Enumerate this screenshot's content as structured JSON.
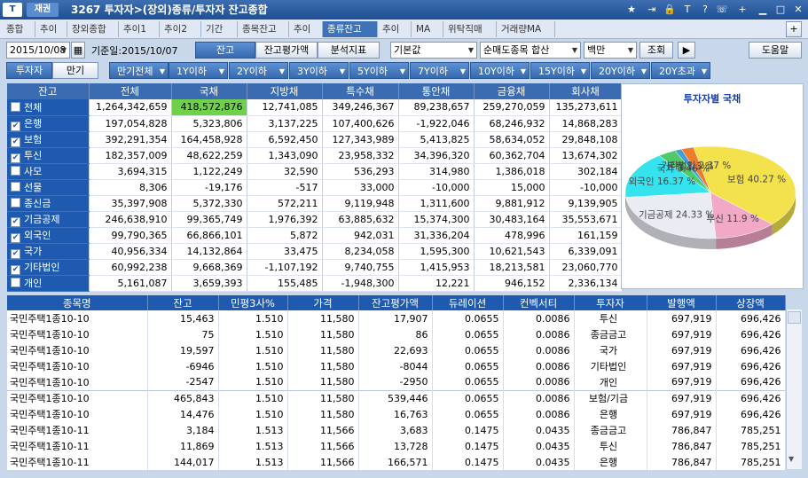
{
  "titlebar": {
    "logo": "T",
    "brand": "재권",
    "title": "3267 투자자>(장외)종류/투자자 잔고종합",
    "icons": [
      "star-icon",
      "exit-icon",
      "lock-icon",
      "text-icon",
      "help-icon",
      "phone-icon",
      "minimize-icon",
      "maximize-icon",
      "close-icon"
    ]
  },
  "tabs": [
    "종합",
    "추이",
    "장외종합",
    "추이1",
    "추이2",
    "기간",
    "종목잔고",
    "추이",
    "종류잔고",
    "추이",
    "MA",
    "위탁직매",
    "거래량MA"
  ],
  "tabs_active_index": 8,
  "toolbar": {
    "date": "2015/10/08",
    "ref_date": "기준일:2015/10/07",
    "balance": "잔고",
    "eval": "잔고평가액",
    "analysis": "분석지표",
    "basis": "기본값",
    "sort": "순매도종목 합산",
    "unit": "백만",
    "query": "조회",
    "next": "▶",
    "help": "도움말"
  },
  "investor_toggle": {
    "a": "투자자",
    "b": "만기"
  },
  "maturity_filters": [
    "만기전체",
    "1Y이하",
    "2Y이하",
    "3Y이하",
    "5Y이하",
    "7Y이하",
    "10Y이하",
    "15Y이하",
    "20Y이하",
    "20Y초과"
  ],
  "table1": {
    "headers": [
      "잔고",
      "전체",
      "국채",
      "지방채",
      "특수채",
      "통안채",
      "금융채",
      "회사채"
    ],
    "rows": [
      {
        "label": "전체",
        "checked": false,
        "v": [
          "1,264,342,659",
          "418,572,876",
          "12,741,085",
          "349,246,367",
          "89,238,657",
          "259,270,059",
          "135,273,611"
        ]
      },
      {
        "label": "은행",
        "checked": true,
        "v": [
          "197,054,828",
          "5,323,806",
          "3,137,225",
          "107,400,626",
          "-1,922,046",
          "68,246,932",
          "14,868,283"
        ]
      },
      {
        "label": "보험",
        "checked": true,
        "v": [
          "392,291,354",
          "164,458,928",
          "6,592,450",
          "127,343,989",
          "5,413,825",
          "58,634,052",
          "29,848,108"
        ]
      },
      {
        "label": "투신",
        "checked": true,
        "v": [
          "182,357,009",
          "48,622,259",
          "1,343,090",
          "23,958,332",
          "34,396,320",
          "60,362,704",
          "13,674,302"
        ]
      },
      {
        "label": "사모",
        "checked": false,
        "v": [
          "3,694,315",
          "1,122,249",
          "32,590",
          "536,293",
          "314,980",
          "1,386,018",
          "302,184"
        ]
      },
      {
        "label": "선물",
        "checked": false,
        "v": [
          "8,306",
          "-19,176",
          "-517",
          "33,000",
          "-10,000",
          "15,000",
          "-10,000"
        ]
      },
      {
        "label": "종신금",
        "checked": false,
        "v": [
          "35,397,908",
          "5,372,330",
          "572,211",
          "9,119,948",
          "1,311,600",
          "9,881,912",
          "9,139,905"
        ]
      },
      {
        "label": "기금공제",
        "checked": true,
        "v": [
          "246,638,910",
          "99,365,749",
          "1,976,392",
          "63,885,632",
          "15,374,300",
          "30,483,164",
          "35,553,671"
        ]
      },
      {
        "label": "외국인",
        "checked": true,
        "v": [
          "99,790,365",
          "66,866,101",
          "5,872",
          "942,031",
          "31,336,204",
          "478,996",
          "161,159"
        ]
      },
      {
        "label": "국가",
        "checked": true,
        "v": [
          "40,956,334",
          "14,132,864",
          "33,475",
          "8,234,058",
          "1,595,300",
          "10,621,543",
          "6,339,091"
        ]
      },
      {
        "label": "기타법인",
        "checked": true,
        "v": [
          "60,992,238",
          "9,668,369",
          "-1,107,192",
          "9,740,755",
          "1,415,953",
          "18,213,581",
          "23,060,770"
        ]
      },
      {
        "label": "개인",
        "checked": false,
        "v": [
          "5,161,087",
          "3,659,393",
          "155,485",
          "-1,948,300",
          "12,221",
          "946,152",
          "2,336,134"
        ]
      }
    ]
  },
  "chart_data": {
    "type": "pie",
    "title": "투자자별 국채",
    "slices": [
      {
        "label": "보험",
        "value": 40.27,
        "color": "#f3e24c"
      },
      {
        "label": "투신",
        "value": 11.9,
        "color": "#f2a9c6"
      },
      {
        "label": "기금공제",
        "value": 24.33,
        "color": "#e9ecf2"
      },
      {
        "label": "외국인",
        "value": 16.37,
        "color": "#35e3ef"
      },
      {
        "label": "국가",
        "value": 3.46,
        "color": "#4fc96a"
      },
      {
        "label": "은행",
        "value": 1.3,
        "color": "#3fa0d9"
      },
      {
        "label": "기타법인",
        "value": 2.37,
        "color": "#ef7b2c"
      }
    ],
    "label_texts": [
      "보험 40.27 %",
      "투신 11.9 %",
      "기금공제 24.33 %",
      "외국인 16.37 %",
      "국가 3.46 %",
      "은행 1.3 %",
      "기타법인 2.37 %"
    ]
  },
  "table2": {
    "headers": [
      "종목명",
      "잔고",
      "민평3사%",
      "가격",
      "잔고평가액",
      "듀레이션",
      "컨벡서티",
      "투자자",
      "발행액",
      "상장액"
    ],
    "rows": [
      [
        "국민주택1종10-10",
        "15,463",
        "1.510",
        "11,580",
        "17,907",
        "0.0655",
        "0.0086",
        "투신",
        "697,919",
        "696,426"
      ],
      [
        "국민주택1종10-10",
        "75",
        "1.510",
        "11,580",
        "86",
        "0.0655",
        "0.0086",
        "종금금고",
        "697,919",
        "696,426"
      ],
      [
        "국민주택1종10-10",
        "19,597",
        "1.510",
        "11,580",
        "22,693",
        "0.0655",
        "0.0086",
        "국가",
        "697,919",
        "696,426"
      ],
      [
        "국민주택1종10-10",
        "-6946",
        "1.510",
        "11,580",
        "-8044",
        "0.0655",
        "0.0086",
        "기타법인",
        "697,919",
        "696,426"
      ],
      [
        "국민주택1종10-10",
        "-2547",
        "1.510",
        "11,580",
        "-2950",
        "0.0655",
        "0.0086",
        "개인",
        "697,919",
        "696,426"
      ],
      [
        "국민주택1종10-10",
        "465,843",
        "1.510",
        "11,580",
        "539,446",
        "0.0655",
        "0.0086",
        "보험/기금",
        "697,919",
        "696,426"
      ],
      [
        "국민주택1종10-10",
        "14,476",
        "1.510",
        "11,580",
        "16,763",
        "0.0655",
        "0.0086",
        "은행",
        "697,919",
        "696,426"
      ],
      [
        "국민주택1종10-11",
        "3,184",
        "1.513",
        "11,566",
        "3,683",
        "0.1475",
        "0.0435",
        "종금금고",
        "786,847",
        "785,251"
      ],
      [
        "국민주택1종10-11",
        "11,869",
        "1.513",
        "11,566",
        "13,728",
        "0.1475",
        "0.0435",
        "투신",
        "786,847",
        "785,251"
      ],
      [
        "국민주택1종10-11",
        "144,017",
        "1.513",
        "11,566",
        "166,571",
        "0.1475",
        "0.0435",
        "은행",
        "786,847",
        "785,251"
      ]
    ]
  }
}
